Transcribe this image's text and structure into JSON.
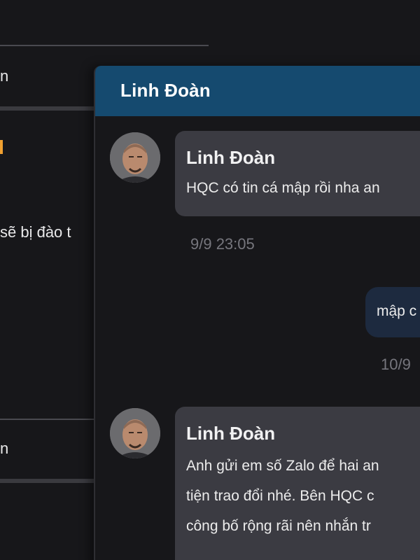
{
  "background": {
    "row1_text": "n",
    "row2_text": "sẽ bị đào t",
    "row3_text": "n"
  },
  "chat": {
    "title": "Linh Đoàn",
    "messages": [
      {
        "direction": "incoming",
        "sender": "Linh Đoàn",
        "lines": [
          "HQC có tin cá mập rồi nha an"
        ],
        "timestamp": "9/9 23:05"
      },
      {
        "direction": "outgoing",
        "lines": [
          "mập c"
        ],
        "timestamp": "10/9"
      },
      {
        "direction": "incoming",
        "sender": "Linh Đoàn",
        "lines": [
          "Anh gửi em số Zalo để hai an",
          "tiện trao đổi nhé. Bên HQC c",
          "công bố rộng rãi nên nhắn tr"
        ]
      }
    ]
  },
  "colors": {
    "header": "#154a6f",
    "incoming_bubble": "#3b3b42",
    "outgoing_bubble": "#1d2a3f",
    "background": "#17171a",
    "accent_orange": "#f0a030"
  },
  "icons": {
    "avatar": "user-avatar-photo"
  }
}
